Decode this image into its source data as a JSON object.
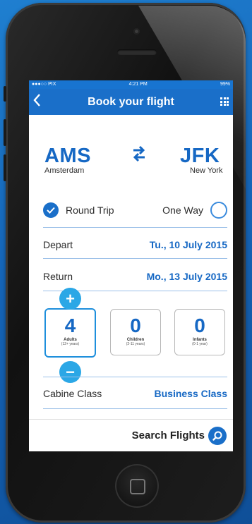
{
  "status": {
    "carrier": "●●●○○ PIX",
    "time": "4:21 PM",
    "battery": "99%"
  },
  "header": {
    "back_icon": "back-chevron-icon",
    "title": "Book your flight",
    "menu_icon": "grid-menu-icon"
  },
  "route": {
    "origin": {
      "code": "AMS",
      "city": "Amsterdam"
    },
    "destination": {
      "code": "JFK",
      "city": "New York"
    }
  },
  "trip_type": {
    "round_trip": "Round Trip",
    "one_way": "One Way",
    "selected": "Round Trip"
  },
  "depart": {
    "label": "Depart",
    "value": "Tu., 10 July 2015"
  },
  "return": {
    "label": "Return",
    "value": "Mo., 13 July 2015"
  },
  "passengers": [
    {
      "count": "4",
      "label": "Adults",
      "range": "(12+ years)"
    },
    {
      "count": "0",
      "label": "Children",
      "range": "(2-11 years)"
    },
    {
      "count": "0",
      "label": "Infants",
      "range": "(0-1 year)"
    }
  ],
  "stepper": {
    "plus": "+",
    "minus": "−"
  },
  "cabin": {
    "label": "Cabine Class",
    "value": "Business Class"
  },
  "search": {
    "label": "Search Flights"
  },
  "colors": {
    "accent": "#1668c4",
    "stepper": "#2ba7e6",
    "navbar": "#1a6fc9"
  }
}
